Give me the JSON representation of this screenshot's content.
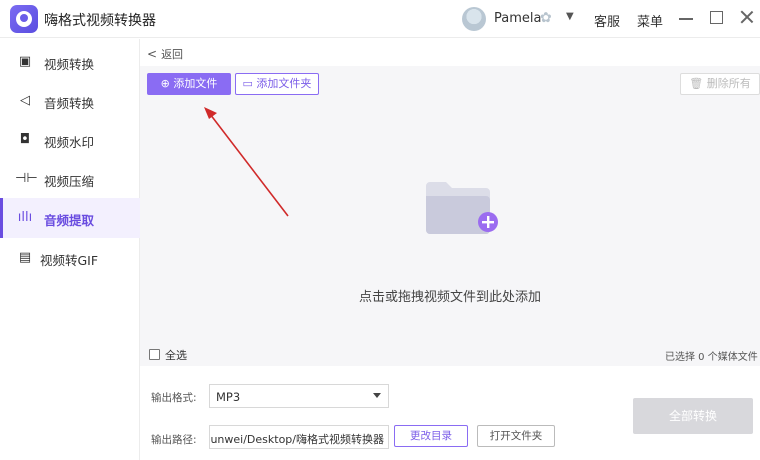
{
  "app": {
    "title": "嗨格式视频转换器"
  },
  "titlebar": {
    "username": "Pamela",
    "vip_glyph": "✿",
    "user_menu_caret": "▼",
    "service": "客服",
    "menu": "菜单"
  },
  "sidebar": {
    "items": [
      {
        "label": "视频转换",
        "icon": "video-convert-icon",
        "glyph": "▣",
        "active": false
      },
      {
        "label": "音频转换",
        "icon": "audio-convert-icon",
        "glyph": "◁",
        "active": false
      },
      {
        "label": "视频水印",
        "icon": "watermark-icon",
        "glyph": "◘",
        "active": false
      },
      {
        "label": "视频压缩",
        "icon": "compress-icon",
        "glyph": "⊣⊢",
        "active": false
      },
      {
        "label": "音频提取",
        "icon": "audio-wave-icon",
        "glyph": "ıllı",
        "active": true
      },
      {
        "label": "视频转GIF",
        "icon": "gif-icon",
        "glyph": "▤",
        "active": false
      }
    ]
  },
  "main": {
    "back_label": "返回",
    "back_glyph": "<",
    "add_file": "⊕ 添加文件",
    "add_folder": "▭ 添加文件夹",
    "clear_all": "🗑 删除所有",
    "drop_hint": "点击或拖拽视频文件到此处添加",
    "select_all": "全选",
    "selected_count": "已选择 0 个媒体文件",
    "output_format_label": "输出格式:",
    "output_format_value": "MP3",
    "output_path_label": "输出路径:",
    "output_path_value": "unwei/Desktop/嗨格式视频转换器",
    "change_dir": "更改目录",
    "open_folder": "打开文件夹",
    "convert_all": "全部转换"
  },
  "colors": {
    "accent": "#8a6cf3",
    "accent_dark": "#6a4de0",
    "arrow": "#d02a2a"
  }
}
